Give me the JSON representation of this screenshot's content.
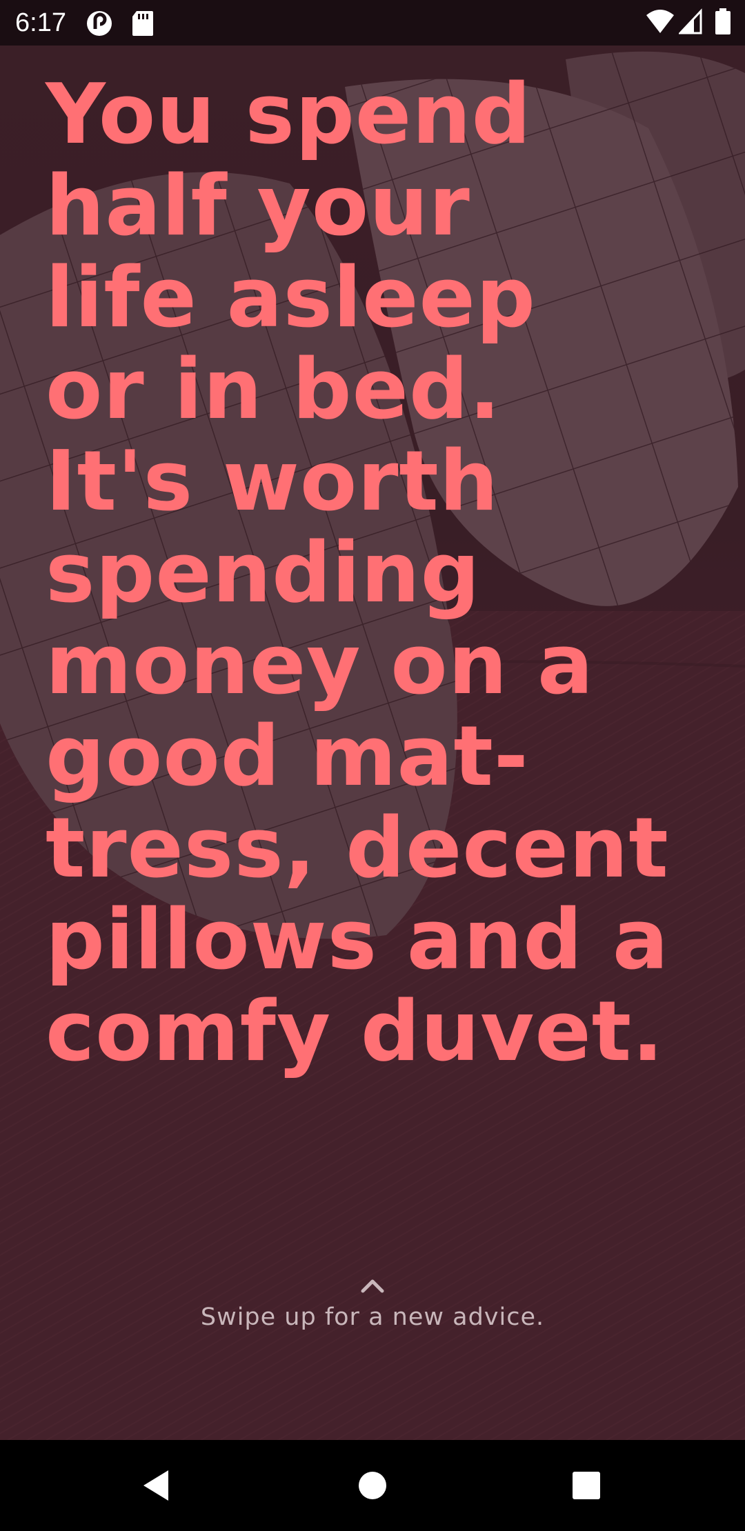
{
  "status_bar": {
    "time": "6:17",
    "notification_icons": [
      "pocket-casts-icon",
      "sd-card-icon"
    ],
    "system_icons": [
      "wifi-icon",
      "cellular-signal-icon",
      "battery-icon"
    ]
  },
  "advice": {
    "text": "You spend\nhalf your\nlife asleep\nor in bed.\nIt's worth\nspending\nmoney on a\ngood mat-\ntress, decent\npillows and a\ncomfy duvet.",
    "color": "#ff7074"
  },
  "swipe_hint": {
    "icon": "chevron-up-icon",
    "label": "Swipe up for a new advice."
  },
  "nav_bar": {
    "buttons": [
      "back-icon",
      "home-icon",
      "recents-icon"
    ]
  },
  "colors": {
    "accent": "#ff7074",
    "background": "#3d2129",
    "hint_text": "#c9b7bb"
  }
}
